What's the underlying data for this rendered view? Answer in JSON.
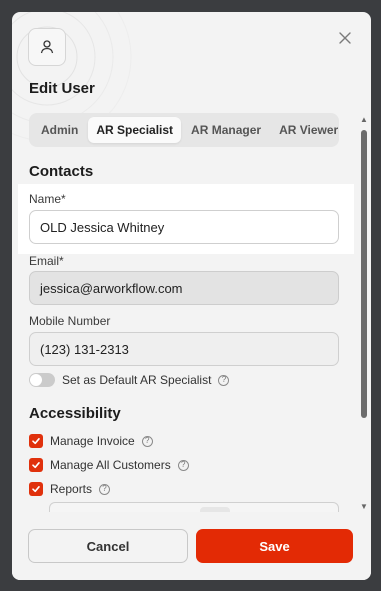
{
  "modal": {
    "title": "Edit User"
  },
  "tabs": [
    {
      "label": "Admin",
      "active": false
    },
    {
      "label": "AR Specialist",
      "active": true
    },
    {
      "label": "AR Manager",
      "active": false
    },
    {
      "label": "AR Viewer",
      "active": false
    }
  ],
  "contacts": {
    "section_title": "Contacts",
    "name_label": "Name*",
    "name_value": "OLD Jessica Whitney",
    "email_label": "Email*",
    "email_value": "jessica@arworkflow.com",
    "mobile_label": "Mobile Number",
    "mobile_value": "(123) 131-2313",
    "default_toggle_label": "Set as Default AR Specialist",
    "default_toggle_on": false
  },
  "accessibility": {
    "section_title": "Accessibility",
    "items": [
      {
        "label": "Manage Invoice",
        "checked": true
      },
      {
        "label": "Manage All Customers",
        "checked": true
      },
      {
        "label": "Reports",
        "checked": true
      }
    ]
  },
  "footer": {
    "cancel_label": "Cancel",
    "save_label": "Save"
  },
  "colors": {
    "accent": "#e32a05",
    "checkbox": "#e0310c"
  },
  "icons": {
    "avatar": "user-icon",
    "close": "close-icon",
    "help": "help-circle-icon",
    "check": "checkmark-icon"
  }
}
